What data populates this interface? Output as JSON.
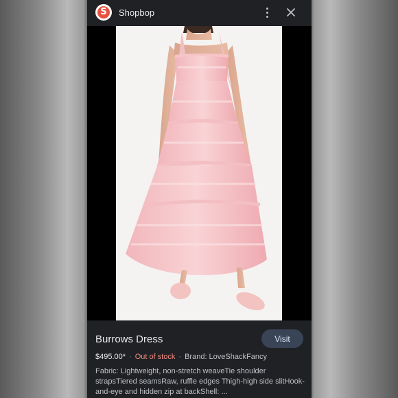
{
  "header": {
    "site_name": "Shopbop",
    "logo_letter": "S",
    "logo_color": "#e8523f",
    "more_icon": "more-vert-icon",
    "close_icon": "close-icon"
  },
  "product": {
    "title": "Burrows Dress",
    "visit_label": "Visit",
    "price": "$495.00*",
    "stock_status": "Out of stock",
    "brand": "Brand: LoveShackFancy",
    "description": "Fabric: Lightweight, non-stretch weaveTie shoulder strapsTiered seamsRaw, ruffle edges Thigh-high side slitHook-and-eye and hidden zip at backShell: ...",
    "stock_color": "#f28b82"
  },
  "colors": {
    "panel_bg": "#202124",
    "visit_bg": "#394457"
  }
}
